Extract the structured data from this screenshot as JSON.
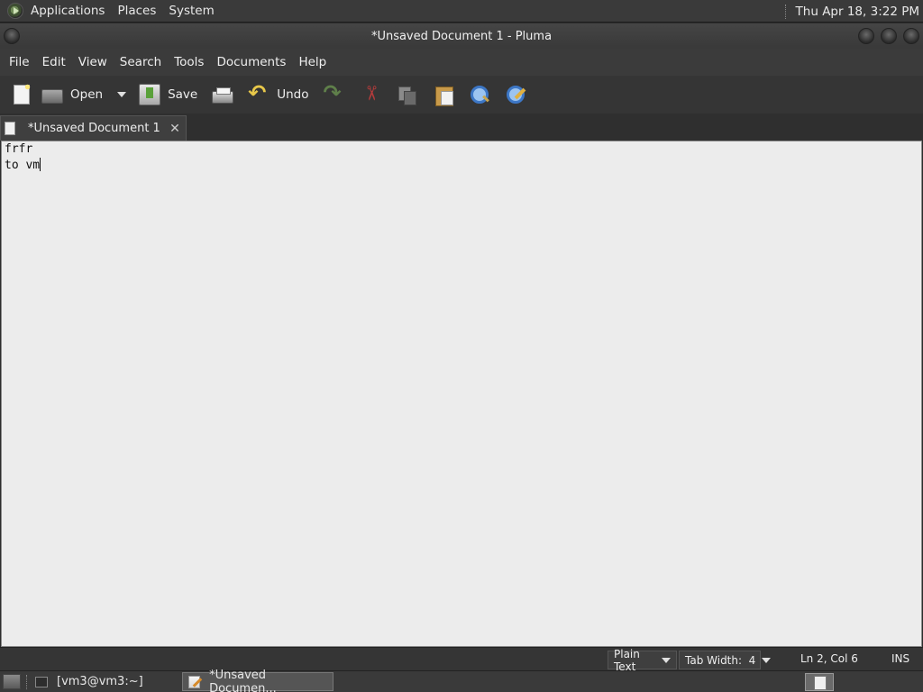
{
  "top_panel": {
    "menus": [
      "Applications",
      "Places",
      "System"
    ],
    "clock": "Thu Apr 18,  3:22 PM"
  },
  "window": {
    "title": "*Unsaved Document 1 - Pluma"
  },
  "menubar": [
    "File",
    "Edit",
    "View",
    "Search",
    "Tools",
    "Documents",
    "Help"
  ],
  "toolbar": {
    "open_label": "Open",
    "save_label": "Save",
    "undo_label": "Undo",
    "icons": [
      "new-document-icon",
      "open-icon",
      "save-icon",
      "print-icon",
      "undo-icon",
      "redo-icon",
      "cut-icon",
      "copy-icon",
      "paste-icon",
      "find-icon",
      "replace-icon"
    ]
  },
  "tab": {
    "label": "*Unsaved Document 1",
    "close": "✕"
  },
  "editor": {
    "lines": [
      "frfr",
      "to vm"
    ]
  },
  "statusbar": {
    "language": "Plain Text",
    "tab_width": "Tab Width:  4",
    "cursor_position": "Ln 2, Col 6",
    "mode": "INS"
  },
  "taskbar": {
    "tasks": [
      "[vm3@vm3:~]",
      "*Unsaved Documen..."
    ]
  }
}
